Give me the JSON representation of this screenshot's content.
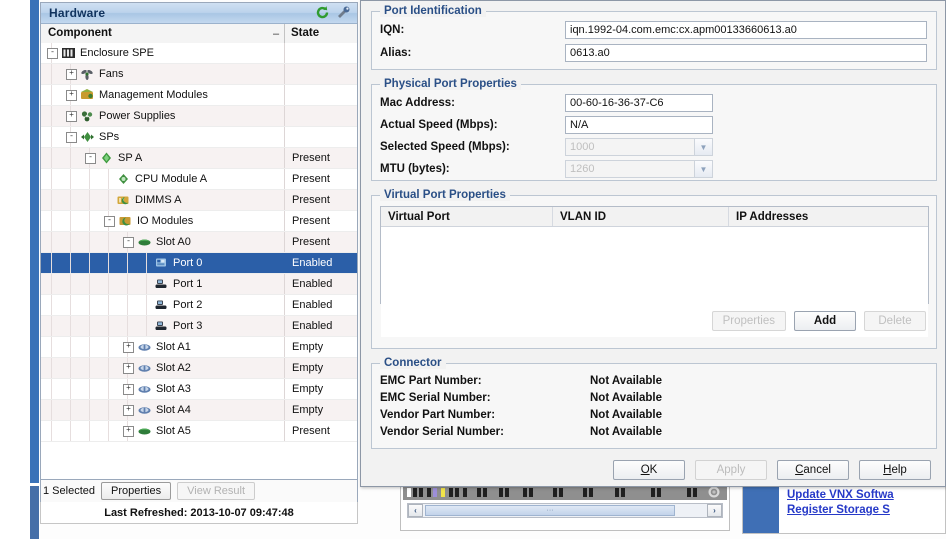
{
  "hardware_panel": {
    "title": "Hardware",
    "tools": [
      {
        "name": "refresh-icon",
        "label": "Refresh"
      },
      {
        "name": "configure-icon",
        "label": "Configure"
      }
    ],
    "columns": {
      "component": "Component",
      "state": "State",
      "sort_indicator": "–"
    },
    "tree": [
      {
        "label": "Enclosure SPE",
        "state": "",
        "depth": 0,
        "expander": "-",
        "icon": "enclosure-icon"
      },
      {
        "label": "Fans",
        "state": "",
        "depth": 1,
        "expander": "+",
        "icon": "fans-icon"
      },
      {
        "label": "Management Modules",
        "state": "",
        "depth": 1,
        "expander": "+",
        "icon": "management-module-icon"
      },
      {
        "label": "Power Supplies",
        "state": "",
        "depth": 1,
        "expander": "+",
        "icon": "power-supply-icon"
      },
      {
        "label": "SPs",
        "state": "",
        "depth": 1,
        "expander": "-",
        "icon": "sp-icon"
      },
      {
        "label": "SP A",
        "state": "Present",
        "depth": 2,
        "expander": "-",
        "icon": "sp-a-icon"
      },
      {
        "label": "CPU Module A",
        "state": "Present",
        "depth": 3,
        "expander": "",
        "icon": "cpu-module-icon"
      },
      {
        "label": "DIMMS A",
        "state": "Present",
        "depth": 3,
        "expander": "",
        "icon": "dimms-icon"
      },
      {
        "label": "IO Modules",
        "state": "Present",
        "depth": 3,
        "expander": "-",
        "icon": "io-modules-icon"
      },
      {
        "label": "Slot A0",
        "state": "Present",
        "depth": 4,
        "expander": "-",
        "icon": "slot-icon"
      },
      {
        "label": "Port 0",
        "state": "Enabled",
        "depth": 5,
        "expander": "",
        "icon": "port-selected-icon",
        "selected": true
      },
      {
        "label": "Port 1",
        "state": "Enabled",
        "depth": 5,
        "expander": "",
        "icon": "port-icon"
      },
      {
        "label": "Port 2",
        "state": "Enabled",
        "depth": 5,
        "expander": "",
        "icon": "port-icon"
      },
      {
        "label": "Port 3",
        "state": "Enabled",
        "depth": 5,
        "expander": "",
        "icon": "port-icon"
      },
      {
        "label": "Slot A1",
        "state": "Empty",
        "depth": 4,
        "expander": "+",
        "icon": "slot-empty-icon"
      },
      {
        "label": "Slot A2",
        "state": "Empty",
        "depth": 4,
        "expander": "+",
        "icon": "slot-empty-icon"
      },
      {
        "label": "Slot A3",
        "state": "Empty",
        "depth": 4,
        "expander": "+",
        "icon": "slot-empty-icon"
      },
      {
        "label": "Slot A4",
        "state": "Empty",
        "depth": 4,
        "expander": "+",
        "icon": "slot-empty-icon"
      },
      {
        "label": "Slot A5",
        "state": "Present",
        "depth": 4,
        "expander": "+",
        "icon": "slot-icon"
      }
    ],
    "status": {
      "selection": "1 Selected",
      "properties_button": "Properties",
      "view_result_button": "View Result",
      "last_refreshed": "Last Refreshed: 2013-10-07 09:47:48"
    }
  },
  "dialog": {
    "port_identification": {
      "title": "Port Identification",
      "iqn_label": "IQN:",
      "iqn_value": "iqn.1992-04.com.emc:cx.apm00133660613.a0",
      "alias_label": "Alias:",
      "alias_value": "0613.a0"
    },
    "physical_port_properties": {
      "title": "Physical Port Properties",
      "mac_label": "Mac Address:",
      "mac_value": "00-60-16-36-37-C6",
      "actual_speed_label": "Actual Speed (Mbps):",
      "actual_speed_value": "N/A",
      "selected_speed_label": "Selected Speed (Mbps):",
      "selected_speed_value": "1000",
      "mtu_label": "MTU (bytes):",
      "mtu_value": "1260"
    },
    "virtual_port_properties": {
      "title": "Virtual Port Properties",
      "columns": [
        "Virtual Port",
        "VLAN ID",
        "IP Addresses"
      ],
      "rows": [],
      "properties_button": "Properties",
      "add_button": "Add",
      "delete_button": "Delete"
    },
    "connector": {
      "title": "Connector",
      "rows": [
        {
          "label": "EMC Part Number:",
          "value": "Not Available"
        },
        {
          "label": "EMC Serial Number:",
          "value": "Not Available"
        },
        {
          "label": "Vendor Part Number:",
          "value": "Not Available"
        },
        {
          "label": "Vendor Serial Number:",
          "value": "Not Available"
        }
      ]
    },
    "buttons": {
      "ok": "OK",
      "apply": "Apply",
      "cancel": "Cancel",
      "help": "Help"
    }
  },
  "background": {
    "links": [
      {
        "label": "Update VNX Softwa"
      },
      {
        "label": "Register Storage S"
      }
    ],
    "scrollbar": {
      "left_arrow": "‹",
      "right_arrow": "›"
    }
  },
  "colors": {
    "selection_blue": "#2b5fa8",
    "group_title_blue": "#2a4f86",
    "link_blue": "#2639c8",
    "accent_strip": "#3a72b8"
  }
}
